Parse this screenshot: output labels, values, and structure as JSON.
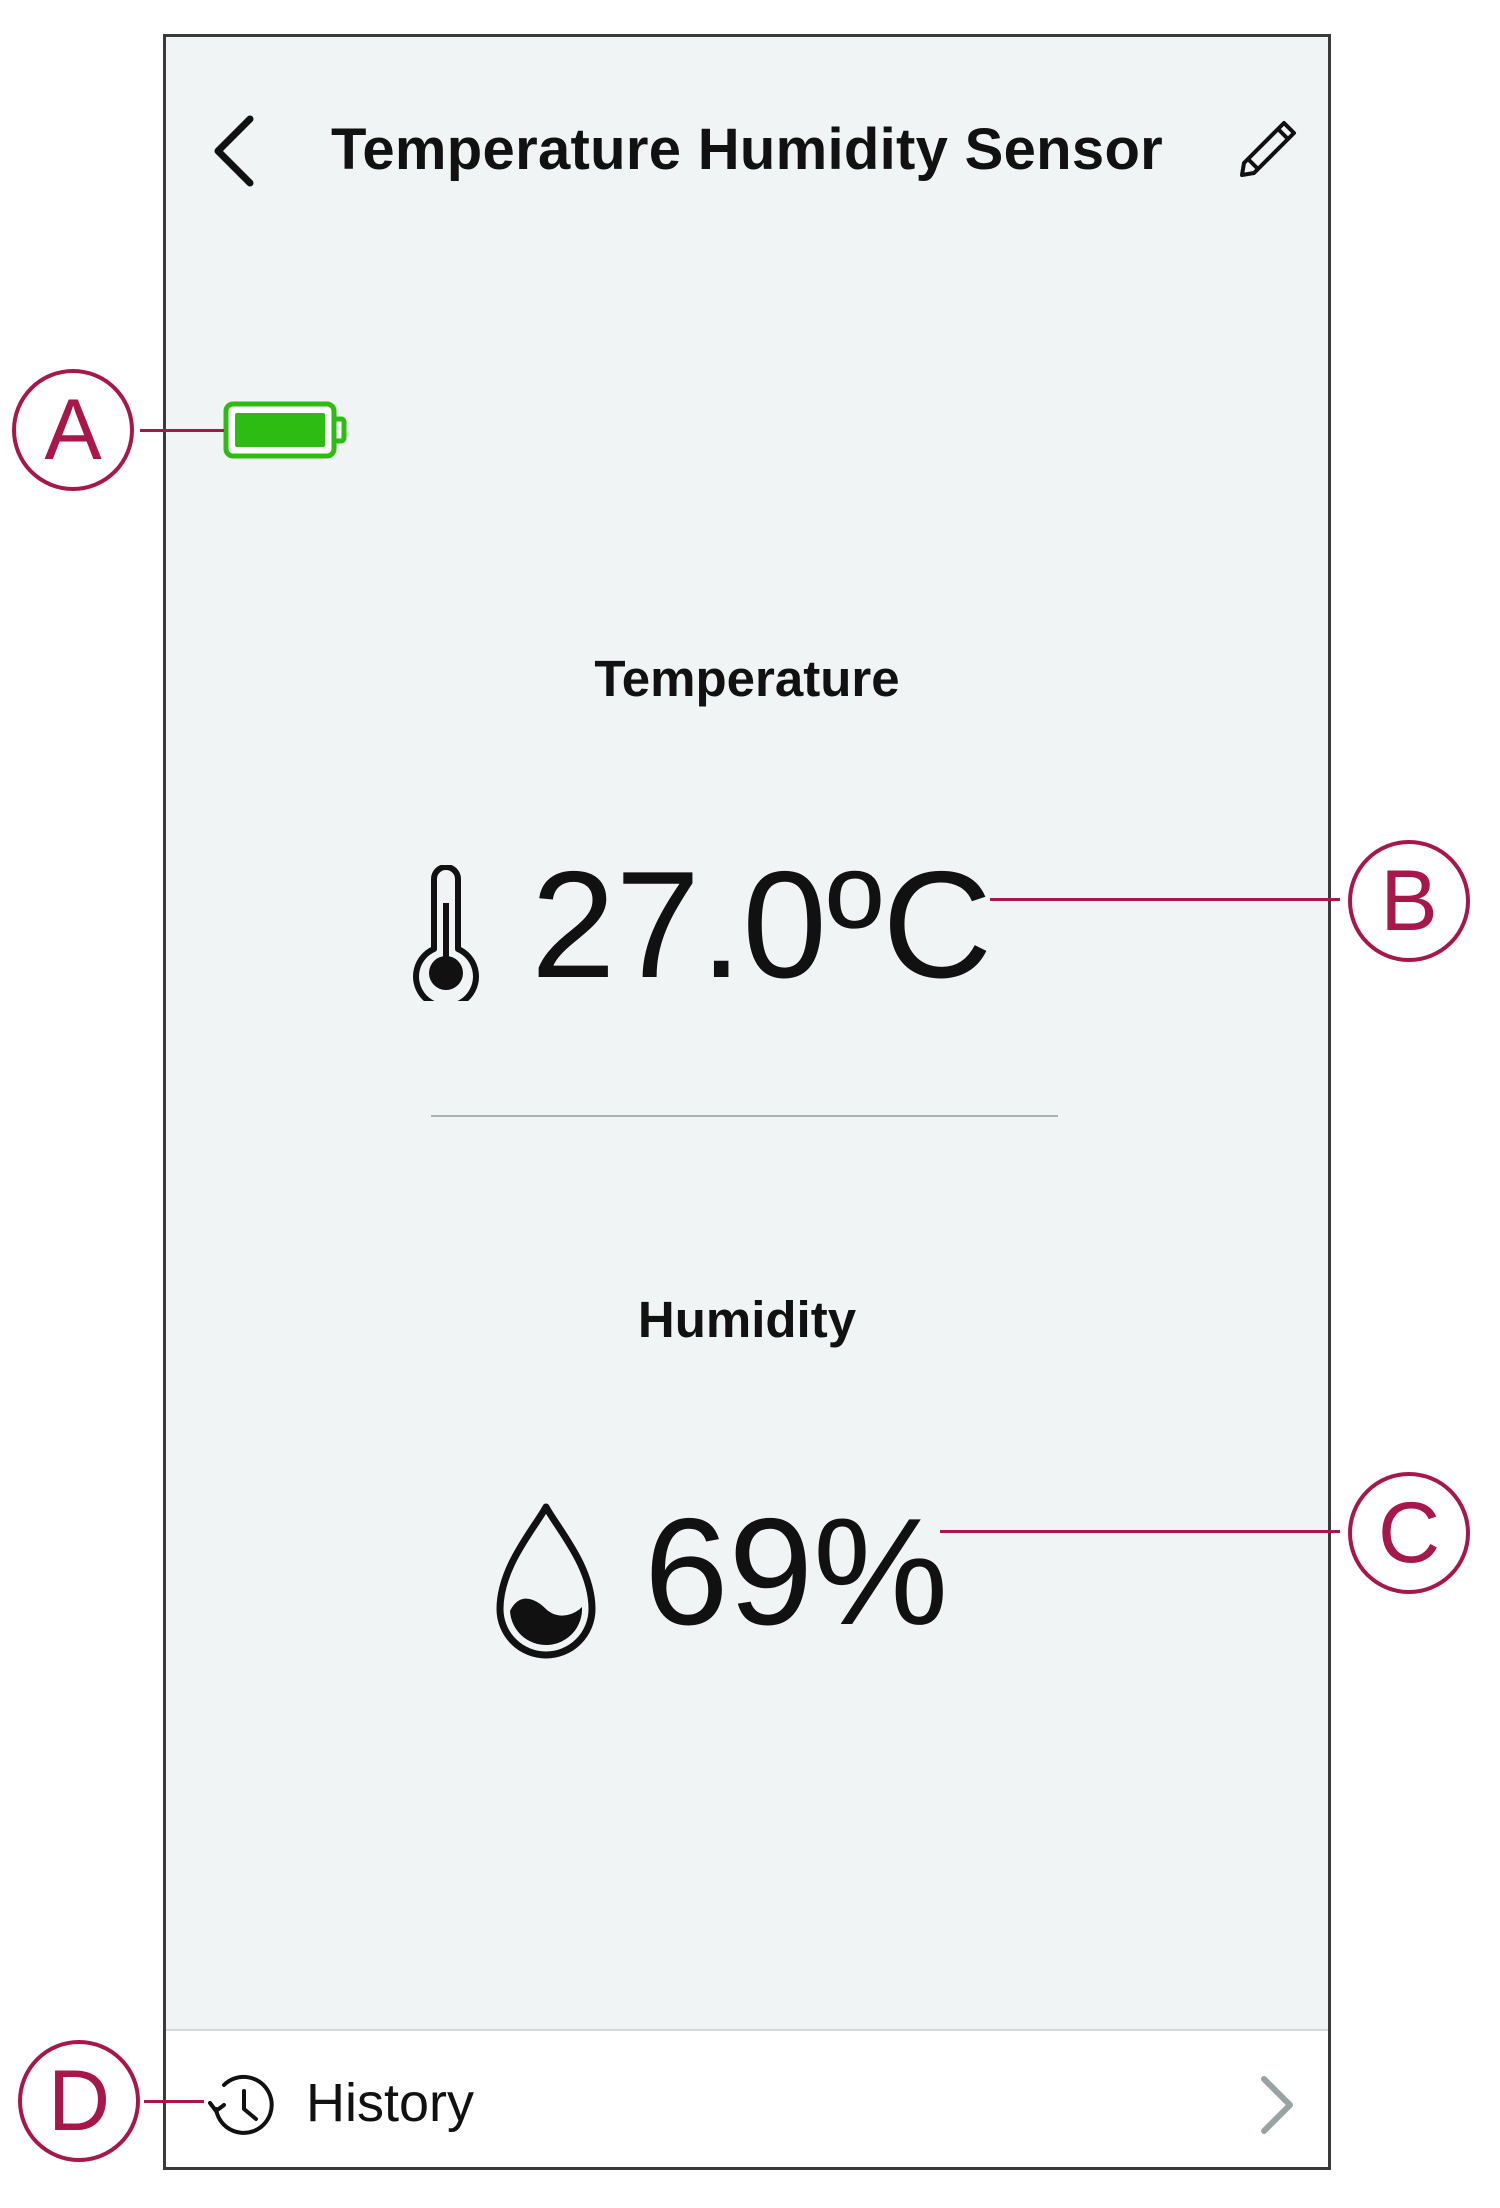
{
  "header": {
    "title": "Temperature Humidity Sensor",
    "back_icon": "chevron-left-icon",
    "edit_icon": "pencil-icon"
  },
  "battery": {
    "icon": "battery-icon",
    "level": 1.0,
    "color": "#2dbd12"
  },
  "temperature": {
    "label": "Temperature",
    "value": "27.0ºC",
    "icon": "thermometer-icon"
  },
  "humidity": {
    "label": "Humidity",
    "value": "69%",
    "icon": "water-drop-icon"
  },
  "history": {
    "label": "History",
    "icon": "history-clock-icon",
    "chevron_icon": "chevron-right-icon"
  },
  "callouts": {
    "a": "A",
    "b": "B",
    "c": "C",
    "d": "D",
    "color": "#a8174a"
  }
}
